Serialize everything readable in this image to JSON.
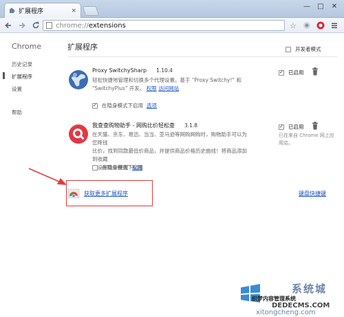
{
  "window": {
    "tab_title": "扩展程序",
    "tab_close": "×",
    "minimize": "—",
    "maximize": "□",
    "close": "✕"
  },
  "toolbar": {
    "url_scheme": "chrome://",
    "url_path": "extensions"
  },
  "sidebar": {
    "brand": "Chrome",
    "items": [
      {
        "label": "历史记录"
      },
      {
        "label": "扩展程序"
      },
      {
        "label": "设置"
      },
      {
        "label": "帮助"
      }
    ]
  },
  "main": {
    "title": "扩展程序",
    "dev_mode_label": "开发者模式",
    "extensions": [
      {
        "name": "Proxy SwitchySharp",
        "version": "1.10.4",
        "desc_line1": "轻松快捷地管理和切换多个代理设置。基于 \"Proxy Switchy!\" 和",
        "desc_line2": "\"SwitchyPlus\" 开发。",
        "link_permissions": "权限",
        "link_website": "访问网站",
        "incognito_label": "在隐身模式下启用",
        "incognito_checked": true,
        "options_link": "选项",
        "enabled_label": "已启用",
        "enabled_checked": true
      },
      {
        "name": "我查查购物助手 - 网购比价轻松查",
        "version": "3.1.8",
        "desc_line1": "在天猫、京东、易迅、当当、亚马逊等网购网购时，购物助手可以为您降钱",
        "desc_line2": "比价，找到同款最低价商品，并提供商品价格历史曲线！将商品添加到收藏",
        "desc_line3": "可设置降价提醒",
        "link_permissions": "权限",
        "incognito_label": "在隐身模式下启用",
        "incognito_checked": false,
        "enabled_label": "已启用",
        "enabled_checked": true,
        "side_note": "已在来自 Chrome 网上应用店。"
      }
    ],
    "get_more": "获取更多扩展程序",
    "shortcuts": "键盘快捷键"
  },
  "watermark": {
    "brand": "系统城",
    "line1": "织梦内容管理系统",
    "line2": "DEDECMS.COM",
    "line3": "xitongcheng.com"
  }
}
